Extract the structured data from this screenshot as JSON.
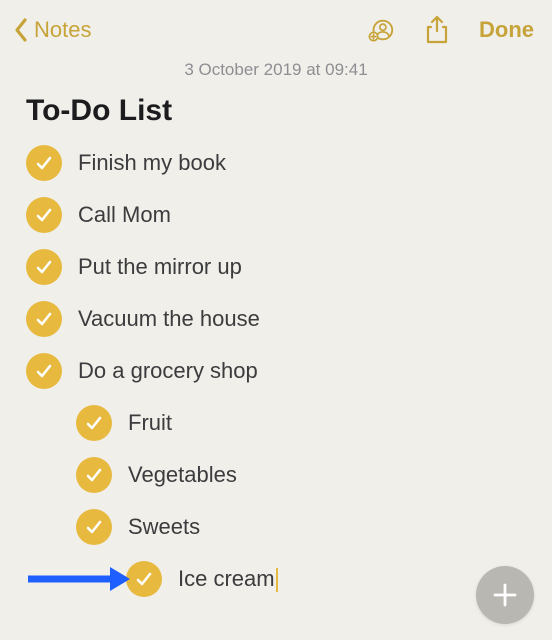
{
  "nav": {
    "back_label": "Notes",
    "done_label": "Done"
  },
  "timestamp": "3 October 2019 at 09:41",
  "title": "To-Do List",
  "items": [
    {
      "text": "Finish my book",
      "checked": true,
      "indent": 0
    },
    {
      "text": "Call Mom",
      "checked": true,
      "indent": 0
    },
    {
      "text": "Put the mirror up",
      "checked": true,
      "indent": 0
    },
    {
      "text": "Vacuum the house",
      "checked": true,
      "indent": 0
    },
    {
      "text": "Do a grocery shop",
      "checked": true,
      "indent": 0
    },
    {
      "text": "Fruit",
      "checked": true,
      "indent": 1
    },
    {
      "text": "Vegetables",
      "checked": true,
      "indent": 1
    },
    {
      "text": "Sweets",
      "checked": true,
      "indent": 1
    },
    {
      "text": "Ice cream",
      "checked": true,
      "indent": 2
    }
  ],
  "colors": {
    "accent": "#c7a43a",
    "check": "#e8b93f",
    "arrow": "#1f5fff"
  }
}
